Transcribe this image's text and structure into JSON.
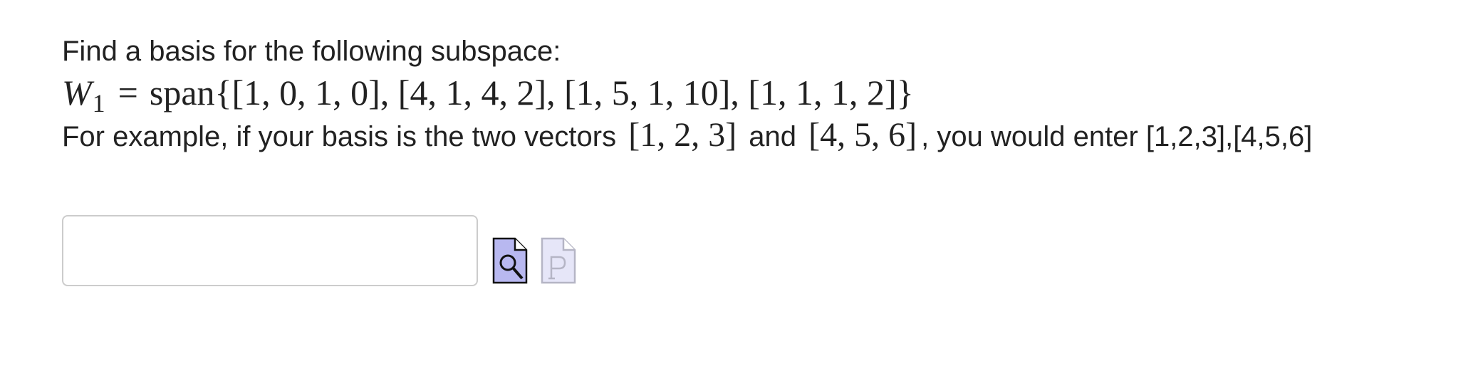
{
  "problem": {
    "prompt": "Find a basis for the following subspace:",
    "subspace_var": "W",
    "subspace_sub": "1",
    "equals": "=",
    "span_expr": "span{[1, 0, 1, 0], [4, 1, 4, 2], [1, 5, 1, 10], [1, 1, 1, 2]}",
    "example_prefix": "For example, if your basis is the two vectors",
    "example_vec1": "[1, 2, 3]",
    "example_and": "and",
    "example_vec2": "[4, 5, 6]",
    "example_suffix": ", you would enter [1,2,3],[4,5,6]"
  },
  "answer": {
    "value": "",
    "placeholder": ""
  },
  "icons": {
    "preview": "preview-magnifier-icon",
    "preview_color": "#b8b8f0",
    "tex": "tex-preview-icon",
    "tex_color": "#e6e6f8"
  }
}
